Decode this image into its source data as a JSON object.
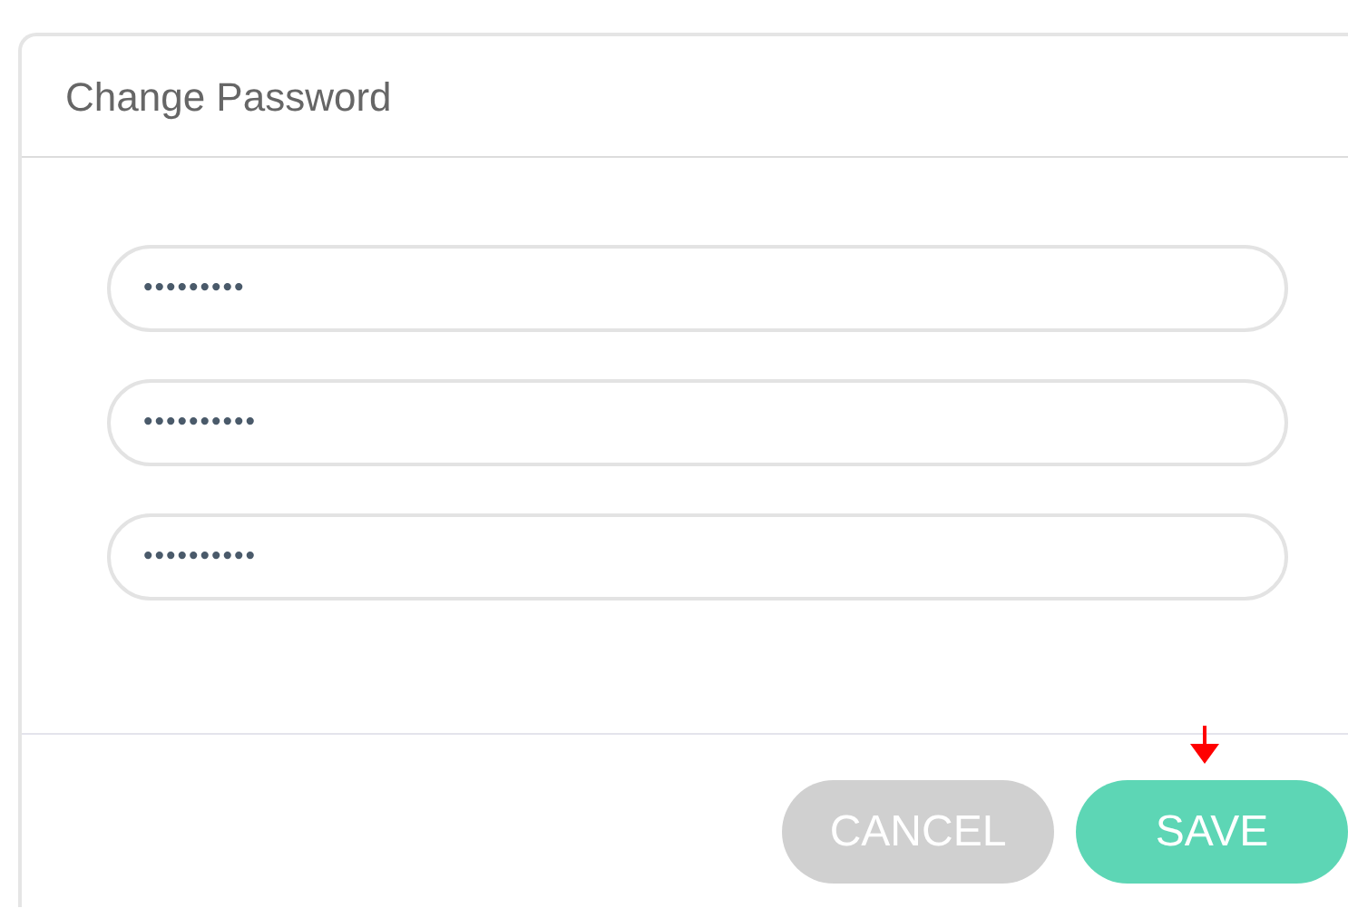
{
  "dialog": {
    "title": "Change Password",
    "fields": [
      {
        "value": "•••••••••"
      },
      {
        "value": "••••••••••"
      },
      {
        "value": "••••••••••"
      }
    ],
    "buttons": [
      {
        "label": "CANCEL",
        "kind": "secondary"
      },
      {
        "label": "SAVE",
        "kind": "primary",
        "pointed": true
      }
    ]
  }
}
